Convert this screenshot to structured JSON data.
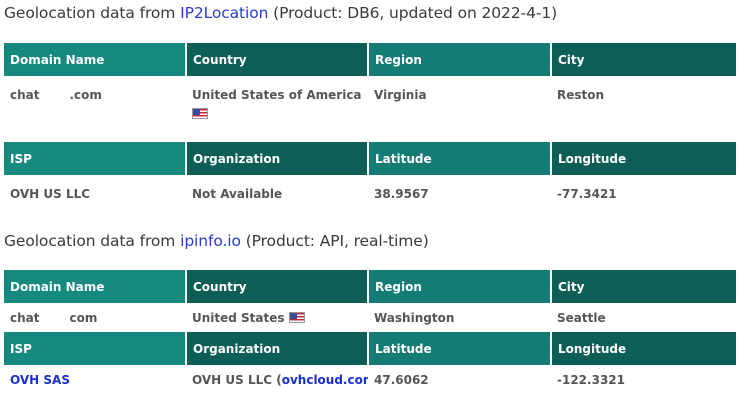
{
  "section1": {
    "prefix": "Geolocation data from ",
    "link": "IP2Location",
    "suffix": " (Product: DB6, updated on 2022-4-1)",
    "headers1": [
      "Domain Name",
      "Country",
      "Region",
      "City"
    ],
    "row1": {
      "domain_a": "chat",
      "domain_b": ".com",
      "country": "United States of America",
      "region": "Virginia",
      "city": "Reston"
    },
    "headers2": [
      "ISP",
      "Organization",
      "Latitude",
      "Longitude"
    ],
    "row2": {
      "isp": "OVH US LLC",
      "organization": "Not Available",
      "latitude": "38.9567",
      "longitude": "-77.3421"
    }
  },
  "section2": {
    "prefix": "Geolocation data from ",
    "link": "ipinfo.io",
    "suffix": " (Product: API, real-time)",
    "headers1": [
      "Domain Name",
      "Country",
      "Region",
      "City"
    ],
    "row1": {
      "domain_a": "chat",
      "domain_b": "com",
      "country": "United States",
      "region": "Washington",
      "city": "Seattle"
    },
    "headers2": [
      "ISP",
      "Organization",
      "Latitude",
      "Longitude"
    ],
    "row2": {
      "isp": "OVH SAS",
      "organization_prefix": "OVH US LLC (",
      "organization_link": "ovhcloud.com",
      "organization_suffix": ")",
      "latitude": "47.6062",
      "longitude": "-122.3321"
    }
  },
  "icons": {
    "flag": "us-flag-icon"
  },
  "colors": {
    "header_dark": "#0e5e58",
    "header_light": "#147c74",
    "link": "#2a3bd6"
  }
}
